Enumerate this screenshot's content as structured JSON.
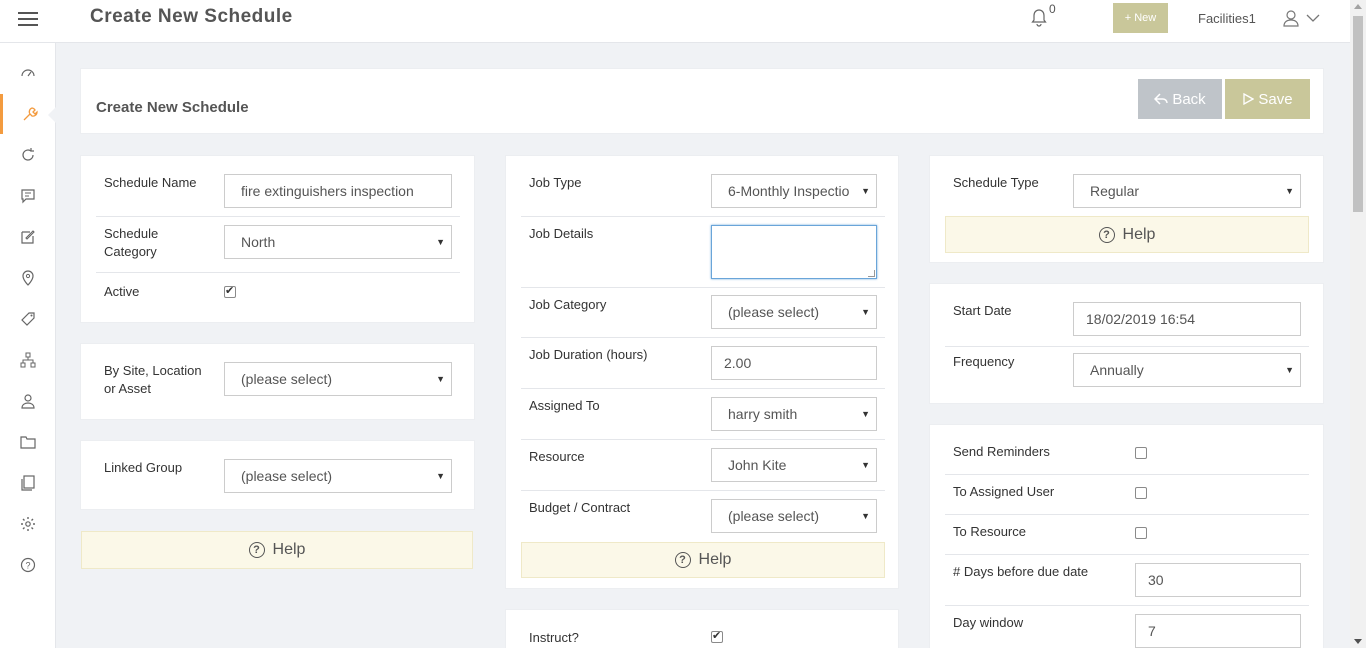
{
  "header": {
    "title": "Create New Schedule",
    "notification_count": "0",
    "new_button": "+ New",
    "user_name": "Facilities1"
  },
  "colors": {
    "accent": "#f39b3f",
    "save": "#c9c79a",
    "back": "#bfc4c9",
    "help_bg": "#fbf8e8"
  },
  "sidebar": {
    "items": [
      {
        "icon": "dashboard-icon"
      },
      {
        "icon": "wrench-icon",
        "active": true
      },
      {
        "icon": "refresh-icon"
      },
      {
        "icon": "chat-icon"
      },
      {
        "icon": "edit-icon"
      },
      {
        "icon": "location-icon"
      },
      {
        "icon": "tag-icon"
      },
      {
        "icon": "sitemap-icon"
      },
      {
        "icon": "contacts-icon"
      },
      {
        "icon": "folder-icon"
      },
      {
        "icon": "documents-icon"
      },
      {
        "icon": "gear-icon"
      },
      {
        "icon": "help-icon"
      }
    ]
  },
  "form_header": {
    "title": "Create New Schedule",
    "back_label": "Back",
    "save_label": "Save"
  },
  "left": {
    "schedule_name_label": "Schedule Name",
    "schedule_name_value": "fire extinguishers inspection",
    "schedule_category_label": "Schedule Category",
    "schedule_category_value": "North",
    "active_label": "Active",
    "by_site_label": "By Site, Location or Asset",
    "by_site_value": "(please select)",
    "linked_group_label": "Linked Group",
    "linked_group_value": "(please select)",
    "help_label": "Help"
  },
  "middle": {
    "job_type_label": "Job Type",
    "job_type_value": "6-Monthly Inspectio",
    "job_details_label": "Job Details",
    "job_category_label": "Job Category",
    "job_category_value": "(please select)",
    "job_duration_label": "Job Duration (hours)",
    "job_duration_value": "2.00",
    "assigned_to_label": "Assigned To",
    "assigned_to_value": "harry smith",
    "resource_label": "Resource",
    "resource_value": "John Kite",
    "budget_label": "Budget / Contract",
    "budget_value": "(please select)",
    "help_label": "Help",
    "instruct_label": "Instruct?"
  },
  "right": {
    "schedule_type_label": "Schedule Type",
    "schedule_type_value": "Regular",
    "help_label": "Help",
    "start_date_label": "Start Date",
    "start_date_value": "18/02/2019 16:54",
    "frequency_label": "Frequency",
    "frequency_value": "Annually",
    "send_reminders_label": "Send Reminders",
    "to_assigned_user_label": "To Assigned User",
    "to_resource_label": "To Resource",
    "days_before_label": "# Days before due date",
    "days_before_value": "30",
    "day_window_label": "Day window",
    "day_window_value": "7"
  }
}
